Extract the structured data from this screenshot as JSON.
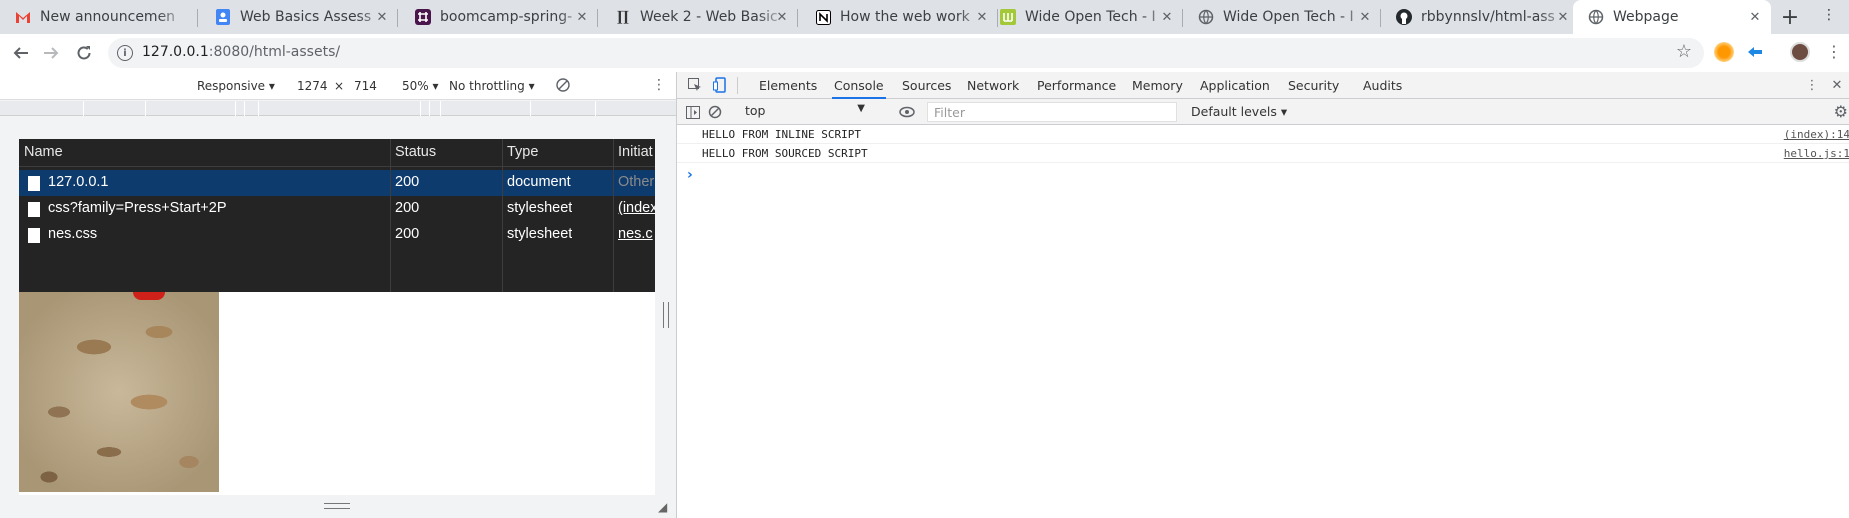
{
  "browser": {
    "tabs": [
      {
        "title": "New announcemen",
        "icon": "gmail-icon"
      },
      {
        "title": "Web Basics Assess",
        "icon": "google-forms-icon"
      },
      {
        "title": "boomcamp-spring-",
        "icon": "slack-icon"
      },
      {
        "title": "Week 2 - Web Basic",
        "icon": "notion-n-icon"
      },
      {
        "title": "How the web work",
        "icon": "notion-icon"
      },
      {
        "title": "Wide Open Tech - I",
        "icon": "wot-icon"
      },
      {
        "title": "Wide Open Tech - I",
        "icon": "globe-icon"
      },
      {
        "title": "rbbynnslv/html-ass",
        "icon": "github-icon"
      },
      {
        "title": "Webpage",
        "icon": "globe-icon",
        "active": true
      }
    ],
    "url_host": "127.0.0.1",
    "url_path": ":8080/html-assets/"
  },
  "device_toolbar": {
    "mode": "Responsive",
    "width": "1274",
    "times": "×",
    "height": "714",
    "zoom": "50%",
    "throttle": "No throttling"
  },
  "network_panel": {
    "columns": [
      "Name",
      "Status",
      "Type",
      "Initiat"
    ],
    "rows": [
      {
        "name": "127.0.0.1",
        "status": "200",
        "type": "document",
        "initiator": "Other"
      },
      {
        "name": "css?family=Press+Start+2P",
        "status": "200",
        "type": "stylesheet",
        "initiator": "(index"
      },
      {
        "name": "nes.css",
        "status": "200",
        "type": "stylesheet",
        "initiator": "nes.c"
      }
    ]
  },
  "devtools": {
    "tabs": [
      "Elements",
      "Console",
      "Sources",
      "Network",
      "Performance",
      "Memory",
      "Application",
      "Security",
      "Audits"
    ],
    "active_tab": "Console",
    "context": "top",
    "filter_placeholder": "Filter",
    "levels": "Default levels",
    "logs": [
      {
        "message": "HELLO FROM INLINE SCRIPT",
        "source": "(index):14"
      },
      {
        "message": "HELLO FROM SOURCED SCRIPT",
        "source": "hello.js:1"
      }
    ],
    "prompt": "›"
  },
  "colors": {
    "tab_strip": "#dee1e6",
    "accent": "#1a73e8",
    "network_bg": "#242424",
    "selected_row": "#0e3b6e"
  }
}
